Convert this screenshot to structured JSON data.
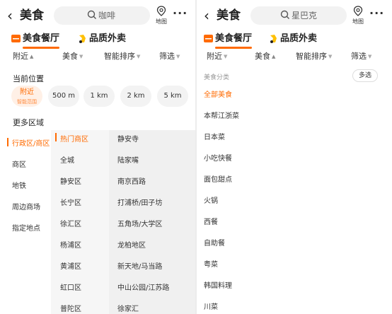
{
  "left": {
    "title": "美食",
    "search_text": "咖啡",
    "map_label": "地图",
    "more": "···",
    "channels": [
      "美食餐厅",
      "品质外卖"
    ],
    "filters": [
      "附近",
      "美食",
      "智能排序",
      "筛选"
    ],
    "current_location_title": "当前位置",
    "chips": [
      {
        "label": "附近",
        "sub": "智能范围"
      },
      {
        "label": "500 m"
      },
      {
        "label": "1 km"
      },
      {
        "label": "2 km"
      },
      {
        "label": "5 km"
      }
    ],
    "more_areas_title": "更多区域",
    "col1": [
      "行政区/商区",
      "商区",
      "地铁",
      "周边商场",
      "指定地点"
    ],
    "col2": [
      "热门商区",
      "全城",
      "静安区",
      "长宁区",
      "徐汇区",
      "杨浦区",
      "黄浦区",
      "虹口区",
      "普陀区"
    ],
    "col3": [
      "静安寺",
      "陆家嘴",
      "南京西路",
      "打浦桥/田子坊",
      "五角场/大学区",
      "龙柏地区",
      "新天地/马当路",
      "中山公园/江苏路",
      "徐家汇"
    ]
  },
  "right": {
    "title": "美食",
    "search_text": "星巴克",
    "map_label": "地图",
    "more": "···",
    "channels": [
      "美食餐厅",
      "品质外卖"
    ],
    "filters": [
      "附近",
      "美食",
      "智能排序",
      "筛选"
    ],
    "category_label": "美食分类",
    "multi_select": "多选",
    "categories": [
      "全部美食",
      "本帮江浙菜",
      "日本菜",
      "小吃快餐",
      "面包甜点",
      "火锅",
      "西餐",
      "自助餐",
      "粤菜",
      "韩国料理",
      "川菜"
    ]
  },
  "colors": {
    "accent": "#ff6a00",
    "chip_bg": "#f3f3f3",
    "panel_bg": "#f6f6f6"
  },
  "icons": [
    "back-arrow-icon",
    "search-icon",
    "map-pin-icon",
    "more-icon",
    "restaurant-icon",
    "delivery-icon",
    "caret-down-icon",
    "caret-up-icon"
  ]
}
